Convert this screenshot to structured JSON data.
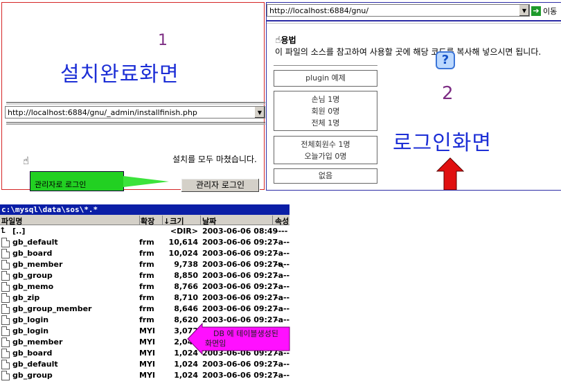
{
  "install": {
    "marker": "1",
    "title": "설치완료화면",
    "url": "http://localhost:6884/gnu/_admin/installfinish.php",
    "done_message": "설치를 모두 마쳤습니다.",
    "green_label": "관리자로 로그인",
    "admin_button": "관리자 로그인",
    "icons": {
      "hand": "hand-pointer-icon",
      "dropdown": "chevron-down-icon"
    }
  },
  "login": {
    "url": "http://localhost:6884/gnu/",
    "go_label": "이동",
    "usage_title": "용법",
    "usage_desc": "이 파일의 소스를 참고하여 사용할 곳에 해당 코드를 복사해 넣으시면 됩니다.",
    "marker": "2",
    "title": "로그인화면",
    "plugin_box": "plugin 예제",
    "visitors": [
      "손님  1명",
      "회원  0명",
      "전체  1명"
    ],
    "members": [
      "전체회원수  1명",
      "오늘가입  0명"
    ],
    "empty_box": "없음",
    "colors": {
      "accent": "#1d2fd6",
      "arrow": "#e01010",
      "marker": "#7d2d84"
    }
  },
  "filemanager": {
    "path": "c:\\mysql\\data\\sos\\*.*",
    "headers": {
      "name": "파일명",
      "ext": "확장",
      "size": "↓크기",
      "date": "날짜",
      "attr": "속성"
    },
    "parent": {
      "name": "[..]",
      "size": "<DIR>",
      "date": "2003-06-06 08:49",
      "attr": "----"
    },
    "files": [
      {
        "name": "gb_default",
        "ext": "frm",
        "size": "10,614",
        "date": "2003-06-06 09:27",
        "attr": "-a--"
      },
      {
        "name": "gb_board",
        "ext": "frm",
        "size": "10,024",
        "date": "2003-06-06 09:27",
        "attr": "-a--"
      },
      {
        "name": "gb_member",
        "ext": "frm",
        "size": "9,738",
        "date": "2003-06-06 09:27",
        "attr": "-a--"
      },
      {
        "name": "gb_group",
        "ext": "frm",
        "size": "8,850",
        "date": "2003-06-06 09:27",
        "attr": "-a--"
      },
      {
        "name": "gb_memo",
        "ext": "frm",
        "size": "8,766",
        "date": "2003-06-06 09:27",
        "attr": "-a--"
      },
      {
        "name": "gb_zip",
        "ext": "frm",
        "size": "8,710",
        "date": "2003-06-06 09:27",
        "attr": "-a--"
      },
      {
        "name": "gb_group_member",
        "ext": "frm",
        "size": "8,646",
        "date": "2003-06-06 09:27",
        "attr": "-a--"
      },
      {
        "name": "gb_login",
        "ext": "frm",
        "size": "8,620",
        "date": "2003-06-06 09:27",
        "attr": "-a--"
      },
      {
        "name": "gb_login",
        "ext": "MYI",
        "size": "3,072",
        "date": "2003-06-06 09:27",
        "attr": "-a--"
      },
      {
        "name": "gb_member",
        "ext": "MYI",
        "size": "2,048",
        "date": "2003-06-06 09:27",
        "attr": "-a--"
      },
      {
        "name": "gb_board",
        "ext": "MYI",
        "size": "1,024",
        "date": "2003-06-06 09:27",
        "attr": "-a--"
      },
      {
        "name": "gb_default",
        "ext": "MYI",
        "size": "1,024",
        "date": "2003-06-06 09:27",
        "attr": "-a--"
      },
      {
        "name": "gb_group",
        "ext": "MYI",
        "size": "1,024",
        "date": "2003-06-06 09:27",
        "attr": "-a--"
      }
    ],
    "callout_line1": "DB 에 테이블생성된",
    "callout_line2": "화면임",
    "callout_color": "#ff10ff"
  }
}
